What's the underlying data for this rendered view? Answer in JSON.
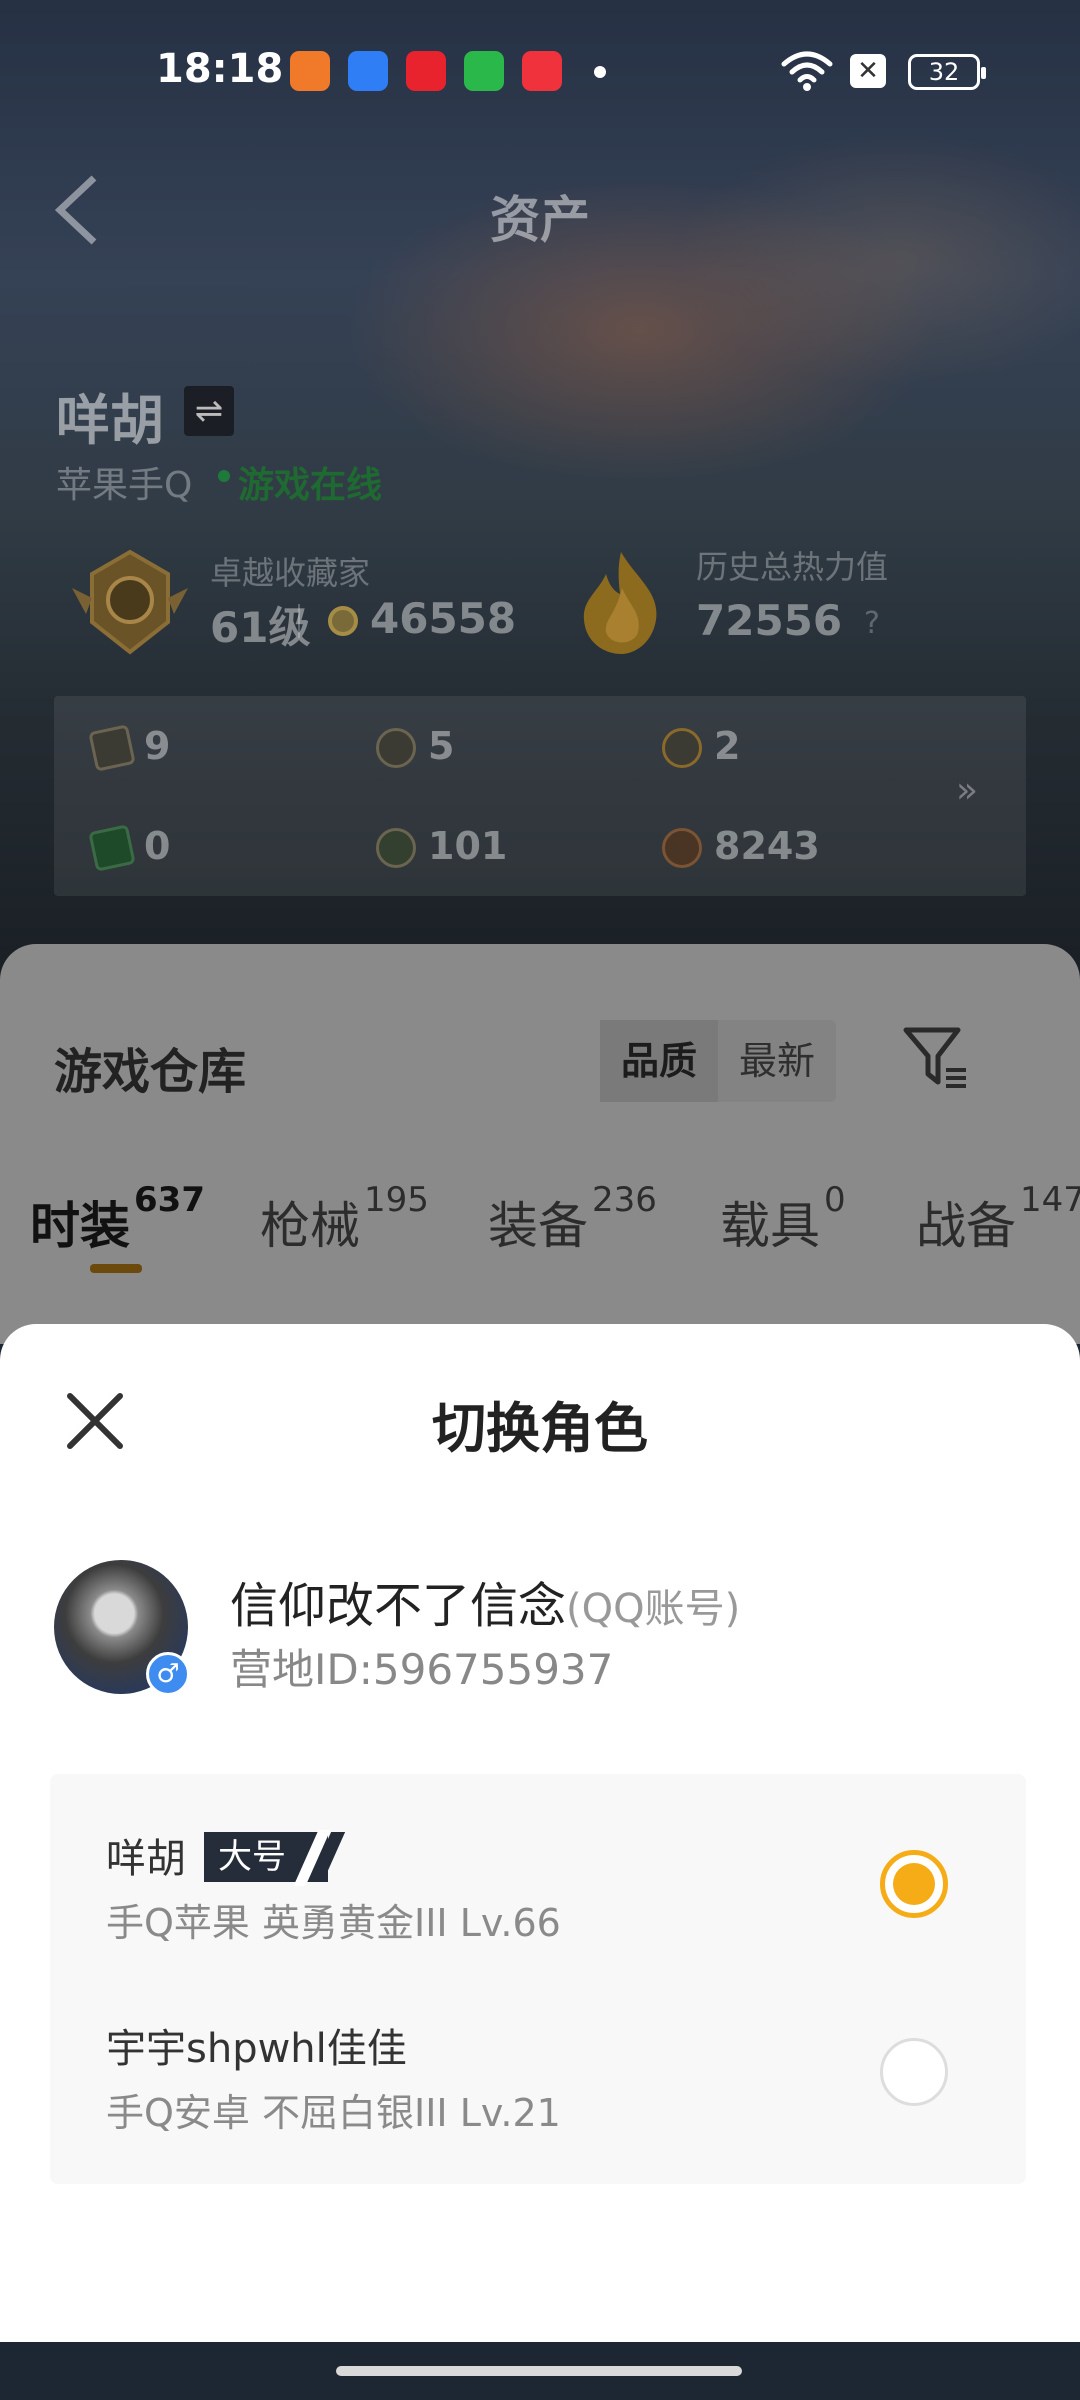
{
  "status_bar": {
    "time": "18:18",
    "battery": "32",
    "sim_indicator": "✕",
    "app_icons": [
      {
        "icon": "orange-app-icon",
        "color": "#f07a2a"
      },
      {
        "icon": "blue-shield-app-icon",
        "color": "#2f7ef5"
      },
      {
        "icon": "red-news-app-icon",
        "color": "#e8232e"
      },
      {
        "icon": "green-battery-app-icon",
        "color": "#2bb84a"
      },
      {
        "icon": "red-music-app-icon",
        "color": "#f0323c"
      }
    ]
  },
  "header": {
    "title": "资产"
  },
  "player": {
    "name": "咩胡",
    "switch_symbol": "⇌",
    "platform": "苹果手Q",
    "online_status": "游戏在线"
  },
  "collection": {
    "label": "卓越收藏家",
    "level": "61级",
    "points": "46558"
  },
  "heat": {
    "label": "历史总热力值",
    "value": "72556",
    "help": "?"
  },
  "stats": [
    {
      "icon": "card-icon",
      "value": "9"
    },
    {
      "icon": "badge-s-icon",
      "value": "5"
    },
    {
      "icon": "badge-a-icon",
      "value": "2"
    },
    {
      "icon": "green-card-icon",
      "value": "0"
    },
    {
      "icon": "helmet-icon",
      "value": "101"
    },
    {
      "icon": "bronze-medal-icon",
      "value": "8243"
    }
  ],
  "stats_more": "»",
  "warehouse": {
    "title": "游戏仓库",
    "sort_options": [
      "品质",
      "最新"
    ],
    "tabs": [
      {
        "label": "时装",
        "count": "637",
        "active": true
      },
      {
        "label": "枪械",
        "count": "195"
      },
      {
        "label": "装备",
        "count": "236"
      },
      {
        "label": "载具",
        "count": "0"
      },
      {
        "label": "战备",
        "count": "147"
      }
    ]
  },
  "sheet": {
    "title": "切换角色",
    "account": {
      "name": "信仰改不了信念",
      "type": "(QQ账号)",
      "camp_id": "营地ID:596755937",
      "gender_symbol": "♂"
    },
    "roles": [
      {
        "name": "咩胡",
        "tag": "大号",
        "info": "手Q苹果  英勇黄金III  Lv.66",
        "selected": true
      },
      {
        "name": "宇宇shpwhl佳佳",
        "tag": "",
        "info": "手Q安卓  不屈白银III  Lv.21",
        "selected": false
      }
    ]
  },
  "colors": {
    "accent": "#f5ac16",
    "online": "#1e6a30",
    "tag_bg": "#262d3a"
  }
}
